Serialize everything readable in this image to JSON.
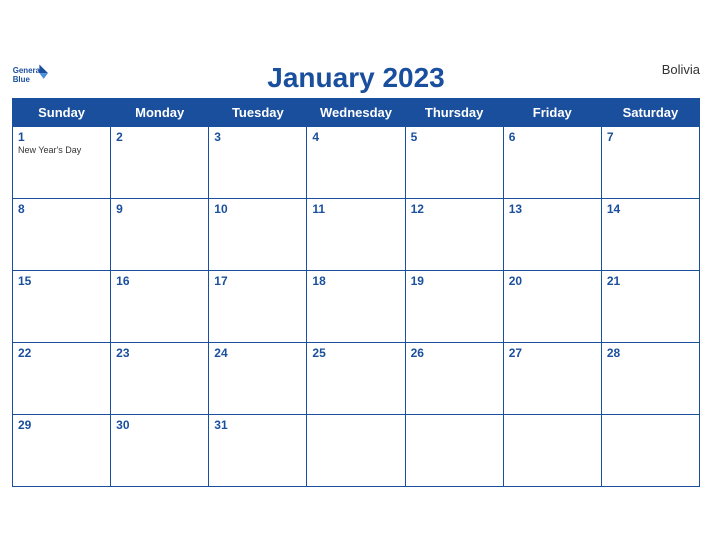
{
  "brand": {
    "general": "General",
    "blue": "Blue",
    "logo_text": "GB"
  },
  "header": {
    "title": "January 2023",
    "country": "Bolivia"
  },
  "weekdays": [
    "Sunday",
    "Monday",
    "Tuesday",
    "Wednesday",
    "Thursday",
    "Friday",
    "Saturday"
  ],
  "weeks": [
    [
      {
        "day": "1",
        "holiday": "New Year's Day"
      },
      {
        "day": "2"
      },
      {
        "day": "3"
      },
      {
        "day": "4"
      },
      {
        "day": "5"
      },
      {
        "day": "6"
      },
      {
        "day": "7"
      }
    ],
    [
      {
        "day": "8"
      },
      {
        "day": "9"
      },
      {
        "day": "10"
      },
      {
        "day": "11"
      },
      {
        "day": "12"
      },
      {
        "day": "13"
      },
      {
        "day": "14"
      }
    ],
    [
      {
        "day": "15"
      },
      {
        "day": "16"
      },
      {
        "day": "17"
      },
      {
        "day": "18"
      },
      {
        "day": "19"
      },
      {
        "day": "20"
      },
      {
        "day": "21"
      }
    ],
    [
      {
        "day": "22"
      },
      {
        "day": "23"
      },
      {
        "day": "24"
      },
      {
        "day": "25"
      },
      {
        "day": "26"
      },
      {
        "day": "27"
      },
      {
        "day": "28"
      }
    ],
    [
      {
        "day": "29"
      },
      {
        "day": "30"
      },
      {
        "day": "31"
      },
      {
        "day": ""
      },
      {
        "day": ""
      },
      {
        "day": ""
      },
      {
        "day": ""
      }
    ]
  ],
  "colors": {
    "header_bg": "#1a4f9e",
    "accent": "#1a4f9e"
  }
}
